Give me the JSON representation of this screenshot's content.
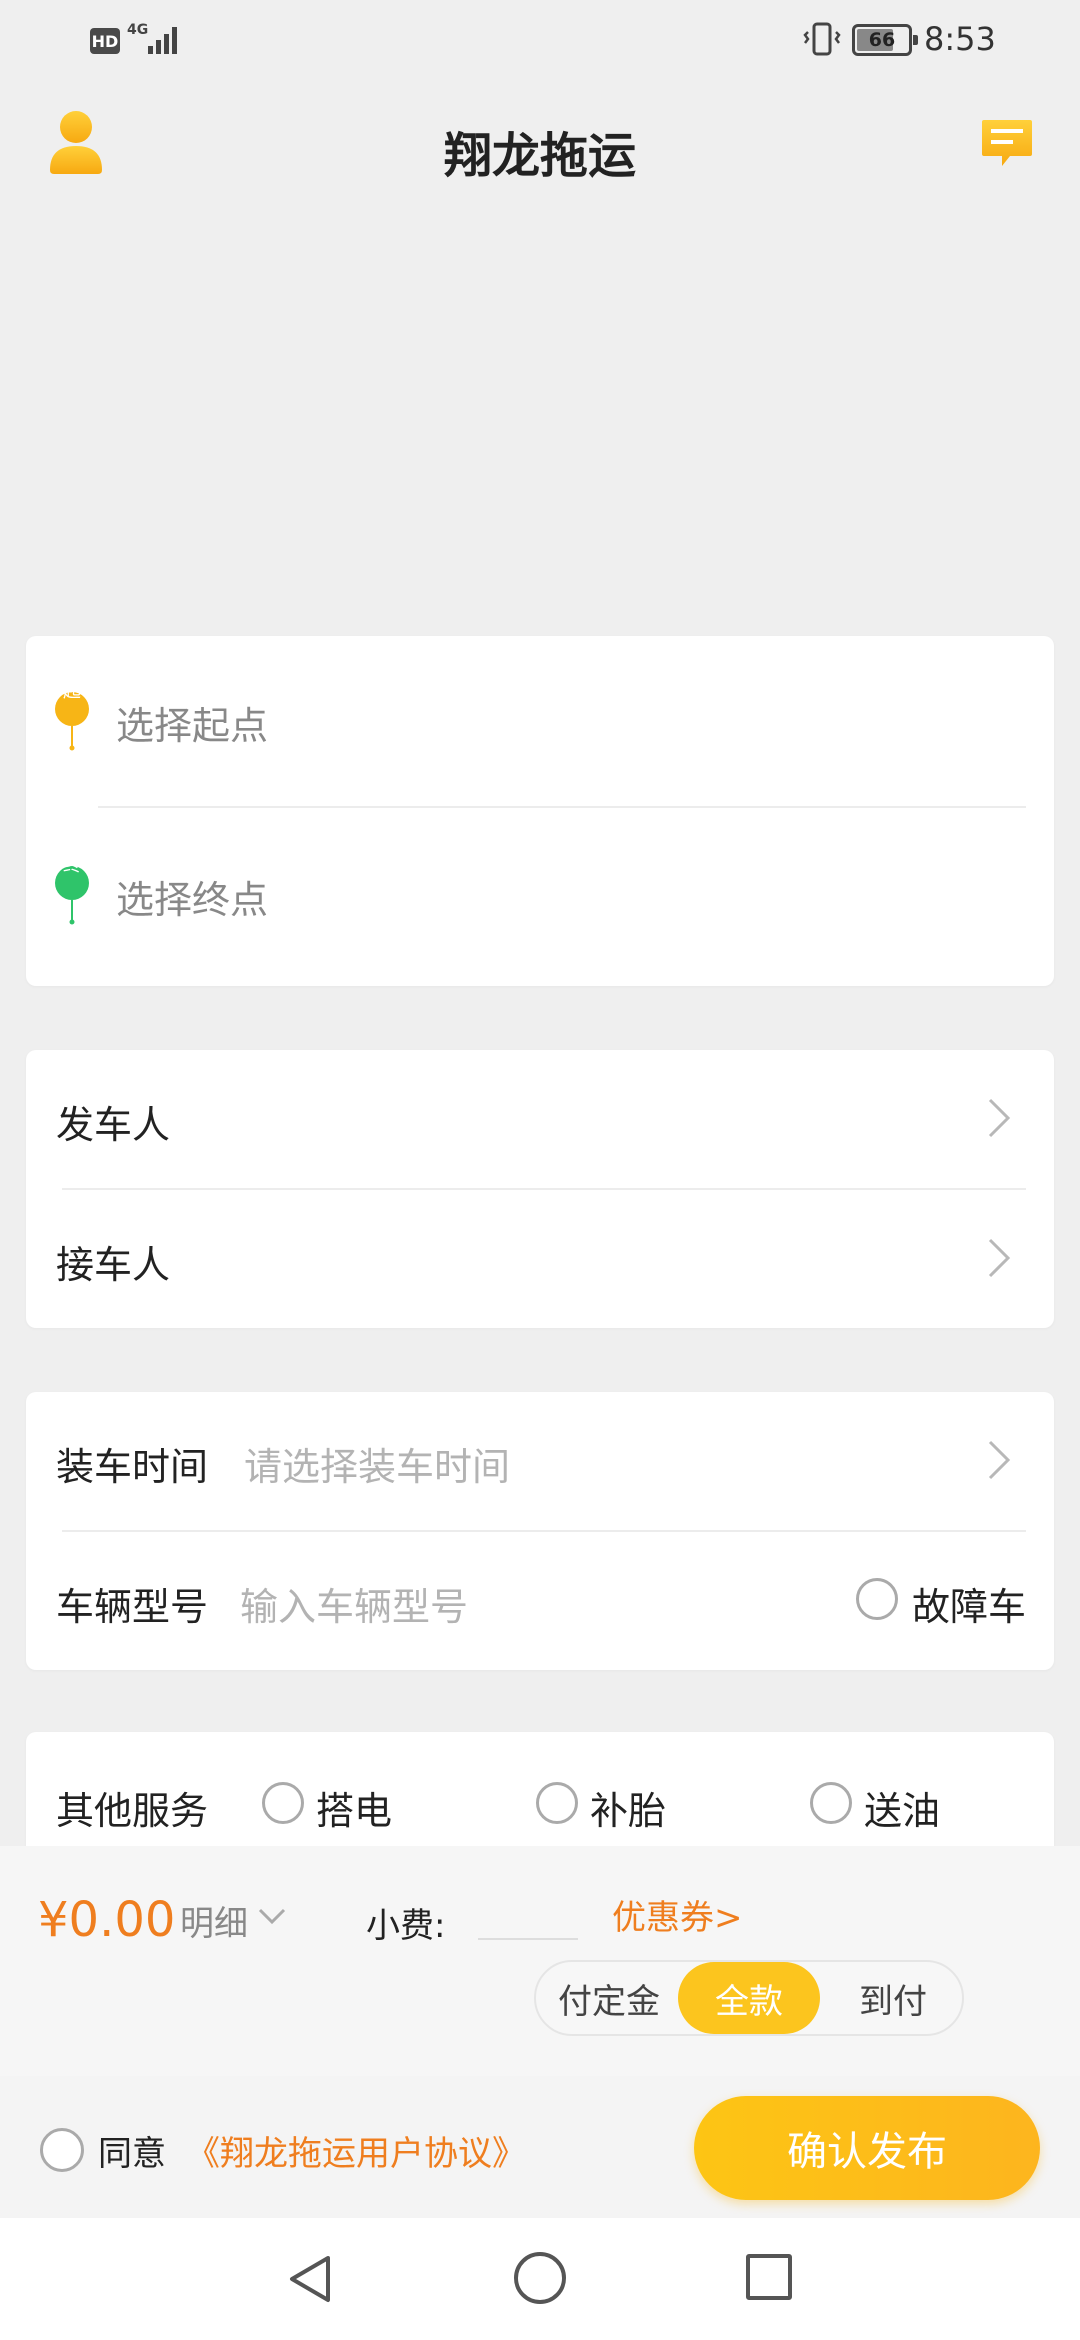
{
  "status_bar": {
    "hd": "HD",
    "network": "4G",
    "battery": "66",
    "battery_level": 0.66,
    "time": "8:53"
  },
  "header": {
    "title": "翔龙拖运",
    "user_icon": "user-icon",
    "message_icon": "message-icon"
  },
  "route": {
    "start_badge": "起",
    "start_placeholder": "选择起点",
    "end_badge": "终",
    "end_placeholder": "选择终点",
    "start_color": "#f7b516",
    "end_color": "#2fc46a"
  },
  "persons": {
    "sender_label": "发车人",
    "receiver_label": "接车人"
  },
  "info": {
    "load_time_label": "装车时间",
    "load_time_placeholder": "请选择装车时间",
    "vehicle_model_label": "车辆型号",
    "vehicle_model_placeholder": "输入车辆型号",
    "fault_label": "故障车"
  },
  "services": {
    "label": "其他服务",
    "options": [
      "搭电",
      "补胎",
      "送油"
    ]
  },
  "summary": {
    "price": "¥0.00",
    "detail_label": "明细",
    "tip_label": "小费:",
    "tip_value": "",
    "coupon_label": "优惠券>"
  },
  "payment": {
    "options": [
      "付定金",
      "全款",
      "到付"
    ],
    "selected": "全款"
  },
  "footer": {
    "agree_label": "同意",
    "agreement_link": "《翔龙拖运用户协议》",
    "confirm_label": "确认发布"
  },
  "colors": {
    "accent": "#fcc51e",
    "price": "#ef7e1f",
    "background": "#efefef"
  }
}
